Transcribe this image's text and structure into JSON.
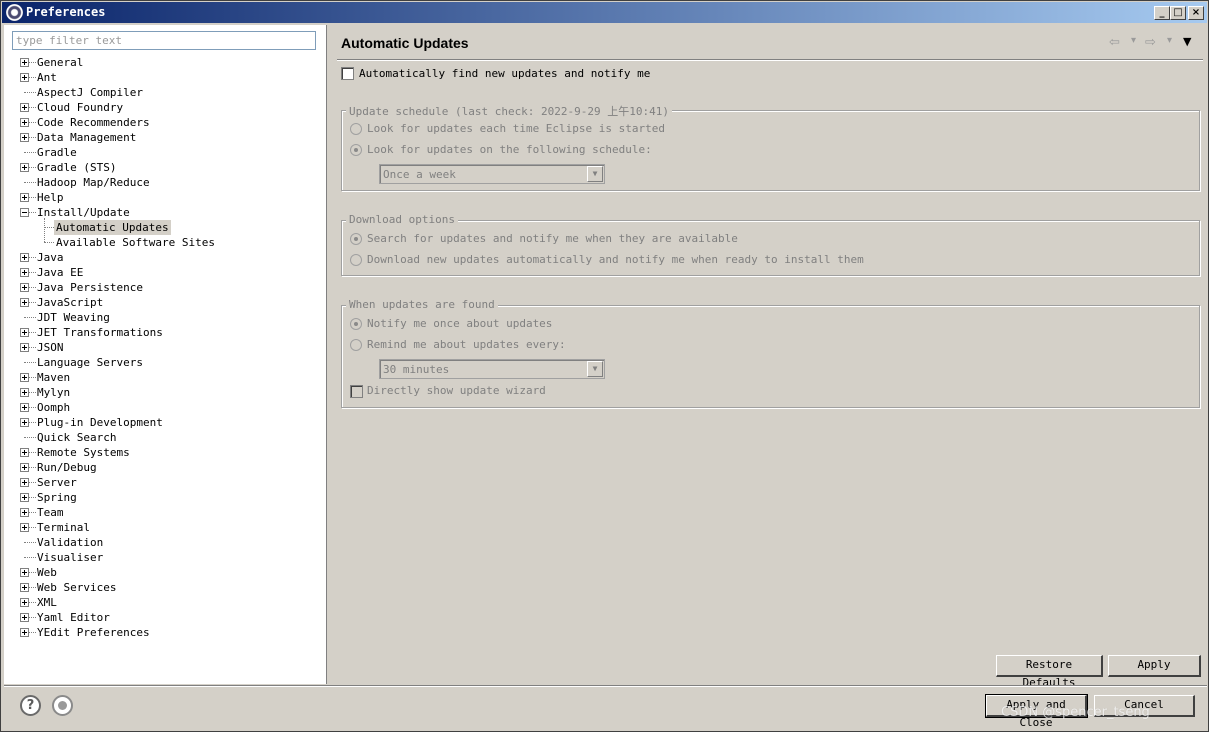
{
  "window": {
    "title": "Preferences",
    "controls": [
      "_",
      "□",
      "×"
    ]
  },
  "filter": {
    "placeholder": "type filter text"
  },
  "tree": {
    "items": [
      {
        "label": "General",
        "expandable": true
      },
      {
        "label": "Ant",
        "expandable": true
      },
      {
        "label": "AspectJ Compiler",
        "expandable": false
      },
      {
        "label": "Cloud Foundry",
        "expandable": true
      },
      {
        "label": "Code Recommenders",
        "expandable": true
      },
      {
        "label": "Data Management",
        "expandable": true
      },
      {
        "label": "Gradle",
        "expandable": false
      },
      {
        "label": "Gradle (STS)",
        "expandable": true
      },
      {
        "label": "Hadoop Map/Reduce",
        "expandable": false
      },
      {
        "label": "Help",
        "expandable": true
      },
      {
        "label": "Install/Update",
        "expandable": true,
        "expanded": true
      },
      {
        "label": "Automatic Updates",
        "child": true,
        "selected": true
      },
      {
        "label": "Available Software Sites",
        "child": true
      },
      {
        "label": "Java",
        "expandable": true
      },
      {
        "label": "Java EE",
        "expandable": true
      },
      {
        "label": "Java Persistence",
        "expandable": true
      },
      {
        "label": "JavaScript",
        "expandable": true
      },
      {
        "label": "JDT Weaving",
        "expandable": false
      },
      {
        "label": "JET Transformations",
        "expandable": true
      },
      {
        "label": "JSON",
        "expandable": true
      },
      {
        "label": "Language Servers",
        "expandable": false
      },
      {
        "label": "Maven",
        "expandable": true
      },
      {
        "label": "Mylyn",
        "expandable": true
      },
      {
        "label": "Oomph",
        "expandable": true
      },
      {
        "label": "Plug-in Development",
        "expandable": true
      },
      {
        "label": "Quick Search",
        "expandable": false
      },
      {
        "label": "Remote Systems",
        "expandable": true
      },
      {
        "label": "Run/Debug",
        "expandable": true
      },
      {
        "label": "Server",
        "expandable": true
      },
      {
        "label": "Spring",
        "expandable": true
      },
      {
        "label": "Team",
        "expandable": true
      },
      {
        "label": "Terminal",
        "expandable": true
      },
      {
        "label": "Validation",
        "expandable": false
      },
      {
        "label": "Visualiser",
        "expandable": false
      },
      {
        "label": "Web",
        "expandable": true
      },
      {
        "label": "Web Services",
        "expandable": true
      },
      {
        "label": "XML",
        "expandable": true
      },
      {
        "label": "Yaml Editor",
        "expandable": true
      },
      {
        "label": "YEdit Preferences",
        "expandable": true
      }
    ]
  },
  "page": {
    "title": "Automatic Updates",
    "nav": {
      "back": "⇦",
      "back_menu": "▾",
      "forward": "⇨",
      "forward_menu": "▾",
      "view_menu": "▼"
    },
    "auto_find_label": "Automatically find new updates and notify me",
    "schedule": {
      "legend": "Update schedule (last check: 2022-9-29 上午10:41)",
      "opt_startup": "Look for updates each time Eclipse is started",
      "opt_schedule": "Look for updates on the following schedule:",
      "interval": "Once a week"
    },
    "download": {
      "legend": "Download options",
      "opt_notify": "Search for updates and notify me when they are available",
      "opt_auto": "Download new updates automatically and notify me when ready to install them"
    },
    "found": {
      "legend": "When updates are found",
      "opt_once": "Notify me once about updates",
      "opt_remind": "Remind me about updates every:",
      "remind_interval": "30 minutes",
      "wizard_label": "Directly show update wizard"
    },
    "restore_defaults": "Restore Defaults",
    "apply": "Apply"
  },
  "footer": {
    "apply_close": "Apply and Close",
    "cancel": "Cancel",
    "help_glyph": "?"
  },
  "watermark": "CSDN @spencer_tseng"
}
